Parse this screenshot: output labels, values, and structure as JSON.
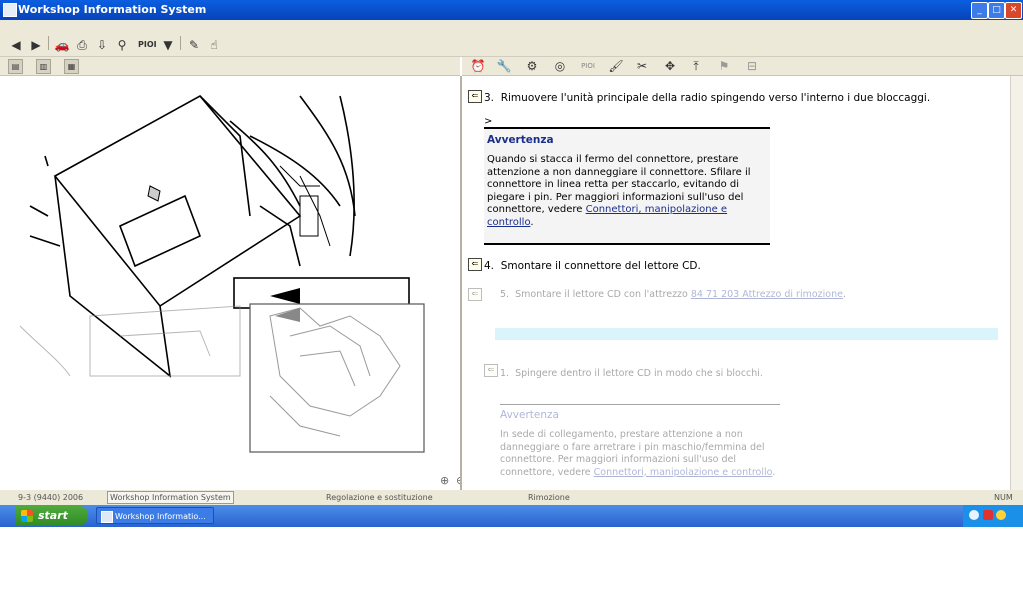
{
  "window": {
    "title": "Workshop Information System",
    "controls": [
      "_",
      "□",
      "✕"
    ]
  },
  "toolbar": {
    "items": [
      "back-icon",
      "forward-icon",
      "car-icon",
      "print-icon",
      "export-icon",
      "binoculars-icon",
      "pioi-label",
      "funnel-icon",
      "pencil-icon",
      "pointer-icon"
    ],
    "pioi_label": "PIOI"
  },
  "right_toolbar": {
    "pioi_label": "PIOI"
  },
  "content": {
    "step3": {
      "number": "3.",
      "text": "Rimuovere l'unità principale della radio spingendo verso l'interno i due bloccaggi."
    },
    "gt_marker": ">",
    "warning1": {
      "title": "Avvertenza",
      "text": "Quando si stacca il fermo del connettore, prestare attenzione a non danneggiare il connettore. Sfilare il connettore in linea retta per staccarlo, evitando di piegare i pin. Per maggiori informazioni sull'uso del connettore, vedere ",
      "link": "Connettori, manipolazione e controllo",
      "tail": "."
    },
    "step4": {
      "number": "4.",
      "text": "Smontare il connettore del lettore CD."
    },
    "step5": {
      "number": "5.",
      "text": "Smontare il lettore CD con l'attrezzo ",
      "link": "84 71 203 Attrezzo di rimozione",
      "tail": "."
    },
    "step1": {
      "number": "1.",
      "text": "Spingere dentro il lettore CD in modo che si blocchi."
    },
    "warning2": {
      "title": "Avvertenza",
      "text": "In sede di collegamento, prestare attenzione a non danneggiare o fare arretrare i pin maschio/femmina del connettore. Per maggiori informazioni sull'uso del connettore, vedere ",
      "link": "Connettori, manipolazione e controllo",
      "tail": "."
    }
  },
  "statusbar": {
    "model": "9-3 (9440) 2006",
    "app": "Workshop Information System",
    "section": "Regolazione e sostituzione",
    "subsection": "Rimozione",
    "num": "NUM"
  },
  "taskbar": {
    "start": "start",
    "task": "Workshop Informatio..."
  }
}
